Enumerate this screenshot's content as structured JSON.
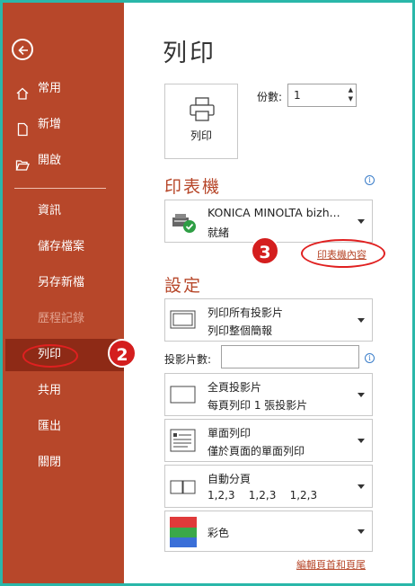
{
  "sidebar": {
    "items": [
      {
        "name": "home",
        "label": "常用"
      },
      {
        "name": "new",
        "label": "新增"
      },
      {
        "name": "open",
        "label": "開啟"
      },
      {
        "name": "info",
        "label": "資訊"
      },
      {
        "name": "save",
        "label": "儲存檔案"
      },
      {
        "name": "save-as",
        "label": "另存新檔"
      },
      {
        "name": "history",
        "label": "歷程記錄"
      },
      {
        "name": "print",
        "label": "列印"
      },
      {
        "name": "share",
        "label": "共用"
      },
      {
        "name": "export",
        "label": "匯出"
      },
      {
        "name": "close",
        "label": "關閉"
      }
    ]
  },
  "page": {
    "title": "列印"
  },
  "print_button": {
    "label": "列印"
  },
  "copies": {
    "label": "份數:",
    "value": "1"
  },
  "printer": {
    "section_title": "印表機",
    "name": "KONICA MINOLTA bizh...",
    "status": "就緒",
    "properties_link": "印表機內容"
  },
  "settings": {
    "section_title": "設定",
    "range": {
      "line1": "列印所有投影片",
      "line2": "列印整個簡報"
    },
    "slides_label": "投影片數:",
    "slides_value": "",
    "layout": {
      "line1": "全頁投影片",
      "line2": "每頁列印 1 張投影片"
    },
    "sides": {
      "line1": "單面列印",
      "line2": "僅於頁面的單面列印"
    },
    "collate": {
      "line1": "自動分頁",
      "line2": "1,2,3    1,2,3    1,2,3"
    },
    "color": {
      "line1": "彩色"
    },
    "header_footer_link": "編輯頁首和頁尾"
  },
  "annotations": {
    "step2": "2",
    "step3": "3"
  },
  "colors": {
    "accent": "#b7472a",
    "accent_dark": "#8e2a16",
    "marker": "#d41e1e"
  }
}
